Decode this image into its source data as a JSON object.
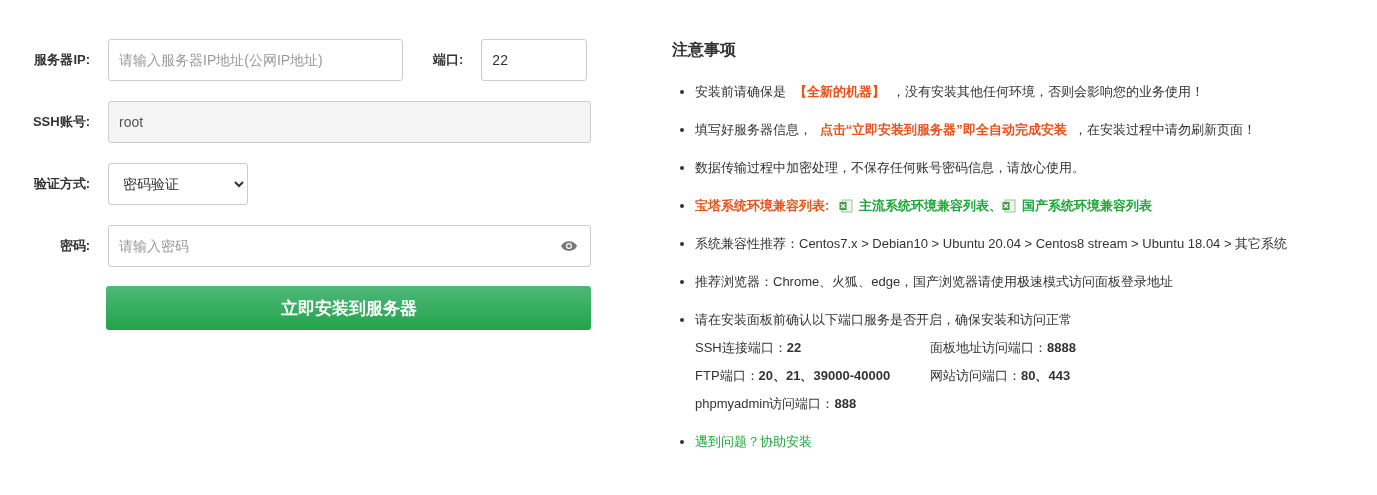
{
  "form": {
    "server_ip": {
      "label": "服务器IP:",
      "placeholder": "请输入服务器IP地址(公网IP地址)"
    },
    "port": {
      "label": "端口:",
      "value": "22"
    },
    "ssh_account": {
      "label": "SSH账号:",
      "value": "root",
      "disabled": true
    },
    "auth_method": {
      "label": "验证方式:",
      "value": "密码验证"
    },
    "password": {
      "label": "密码:",
      "placeholder": "请输入密码"
    },
    "submit_button": "立即安装到服务器"
  },
  "notes": {
    "title": "注意事项",
    "items": [
      {
        "kind": "text",
        "text": "安装前请确保是 **【全新的机器】** ，没有安装其他任何环境，否则会影响您的业务使用！"
      },
      {
        "kind": "text",
        "text": "填写好服务器信息， **点击“立即安装到服务器”即全自动完成安装** ，在安装过程中请勿刷新页面！"
      },
      {
        "kind": "text",
        "text": "数据传输过程中加密处理，不保存任何账号密码信息，请放心使用。"
      },
      {
        "kind": "links",
        "label": "宝塔系统环境兼容列表:",
        "links": [
          {
            "text": "主流系统环境兼容列表",
            "separator": "、"
          },
          {
            "text": "国产系统环境兼容列表"
          }
        ]
      },
      {
        "kind": "text",
        "text": "系统兼容性推荐：Centos7.x > Debian10 > Ubuntu 20.04 > Centos8 stream > Ubuntu 18.04 > 其它系统"
      },
      {
        "kind": "text",
        "text": "推荐浏览器：Chrome、火狐、edge，国产浏览器请使用极速模式访问面板登录地址"
      },
      {
        "kind": "ports",
        "text": "请在安装面板前确认以下端口服务是否开启，确保安装和访问正常",
        "ports": [
          {
            "label": "SSH连接端口：",
            "value": "22"
          },
          {
            "label": "面板地址访问端口：",
            "value": "8888"
          },
          {
            "label": "FTP端口：",
            "value": "20、21、39000-40000"
          },
          {
            "label": "网站访问端口：",
            "value": "80、443"
          },
          {
            "label": "phpmyadmin访问端口：",
            "value": "888"
          }
        ]
      },
      {
        "kind": "link",
        "text": "遇到问题？协助安装"
      }
    ]
  }
}
